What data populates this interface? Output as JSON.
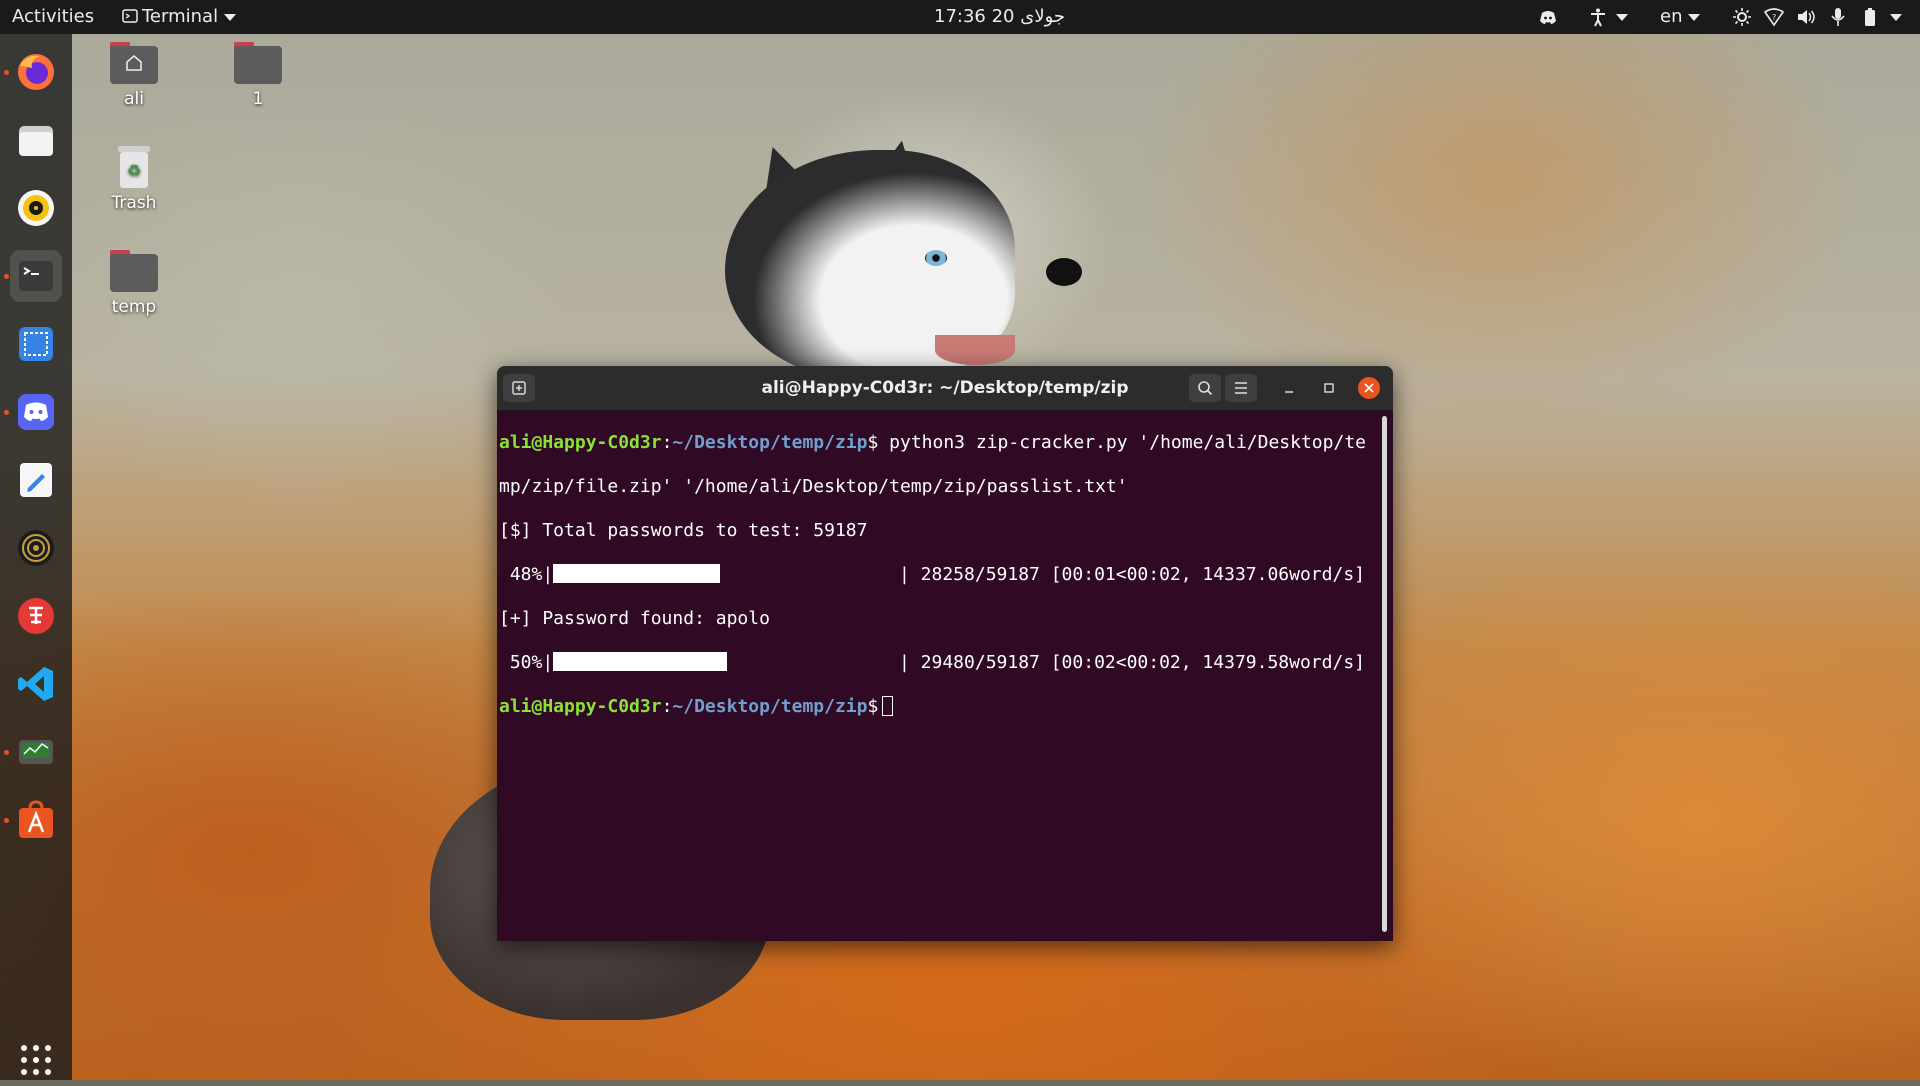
{
  "topbar": {
    "activities": "Activities",
    "app_menu": "Terminal",
    "clock": "17:36  20 جولای",
    "language": "en",
    "status_icons": [
      "discord-tray-icon",
      "accessibility-icon",
      "brightness-icon",
      "network-icon",
      "volume-icon",
      "microphone-icon",
      "battery-icon",
      "system-menu-chevron-icon"
    ]
  },
  "dock": {
    "apps": [
      {
        "name": "firefox",
        "running": true
      },
      {
        "name": "files",
        "running": false
      },
      {
        "name": "rhythmbox",
        "running": false
      },
      {
        "name": "terminal",
        "running": true,
        "active": true
      },
      {
        "name": "screenshot",
        "running": false
      },
      {
        "name": "discord",
        "running": true
      },
      {
        "name": "text-editor",
        "running": false
      },
      {
        "name": "speaker-app",
        "running": false
      },
      {
        "name": "app-red",
        "running": false
      },
      {
        "name": "vscode",
        "running": false
      },
      {
        "name": "system-monitor",
        "running": true
      },
      {
        "name": "software-center",
        "running": true
      },
      {
        "name": "show-applications",
        "running": false
      }
    ]
  },
  "desktop": {
    "icons": [
      {
        "label": "ali",
        "type": "home-folder"
      },
      {
        "label": "1",
        "type": "folder"
      },
      {
        "label": "Trash",
        "type": "trash"
      },
      {
        "label": "temp",
        "type": "folder"
      }
    ]
  },
  "terminal": {
    "title": "ali@Happy-C0d3r: ~/Desktop/temp/zip",
    "prompt_user": "ali@Happy-C0d3r",
    "prompt_sep": ":",
    "prompt_path": "~/Desktop/temp/zip",
    "prompt_end": "$",
    "cmd_line1": " python3 zip-cracker.py '/home/ali/Desktop/te",
    "cmd_line2": "mp/zip/file.zip' '/home/ali/Desktop/temp/zip/passlist.txt'",
    "total_line": "[$] Total passwords to test: 59187",
    "progress1": {
      "percent": " 48%|",
      "fraction": 0.48,
      "stats": "| 28258/59187 [00:01<00:02, 14337.06word/s]"
    },
    "found_line": "[+] Password found: apolo",
    "progress2": {
      "percent": " 50%|",
      "fraction": 0.5,
      "stats": "| 29480/59187 [00:02<00:02, 14379.58word/s]"
    }
  },
  "colors": {
    "terminal_bg": "#300a24",
    "prompt_user": "#8ae234",
    "prompt_path": "#729fcf",
    "close_button": "#e95420"
  }
}
